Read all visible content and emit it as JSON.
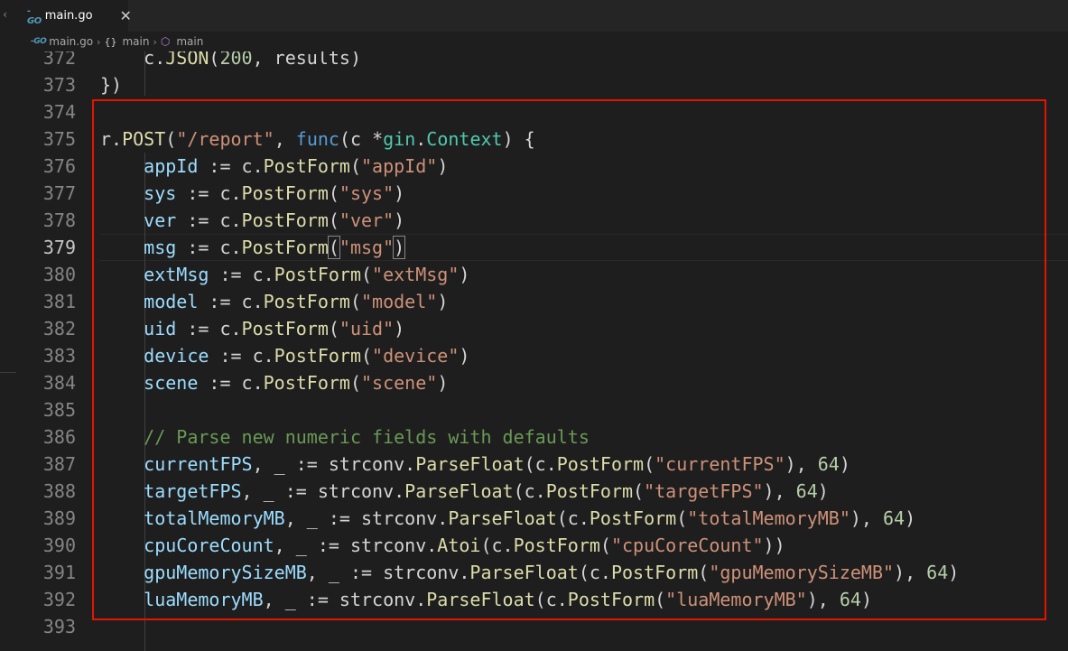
{
  "tab": {
    "icon": "go-file-icon",
    "title": "main.go",
    "close": "✕"
  },
  "breadcrumb": {
    "file": "main.go",
    "scope1_label": "main",
    "scope2_label": "main",
    "separator": "›"
  },
  "editor": {
    "active_line": 379,
    "lines": [
      {
        "n": "372",
        "segs": [
          [
            "    c.",
            "plain"
          ],
          [
            "JSON",
            "fn"
          ],
          [
            "(",
            "plain"
          ],
          [
            "200",
            "num"
          ],
          [
            ", results)",
            "plain"
          ]
        ]
      },
      {
        "n": "373",
        "segs": [
          [
            "})",
            "plain"
          ]
        ]
      },
      {
        "n": "374",
        "segs": []
      },
      {
        "n": "375",
        "segs": [
          [
            "r.",
            "plain"
          ],
          [
            "POST",
            "fn"
          ],
          [
            "(",
            "plain"
          ],
          [
            "\"/report\"",
            "str"
          ],
          [
            ", ",
            "plain"
          ],
          [
            "func",
            "kw"
          ],
          [
            "(c *",
            "plain"
          ],
          [
            "gin",
            "typ"
          ],
          [
            ".",
            "plain"
          ],
          [
            "Context",
            "typ"
          ],
          [
            ") {",
            "plain"
          ]
        ]
      },
      {
        "n": "376",
        "segs": [
          [
            "    ",
            "plain"
          ],
          [
            "appId",
            "var"
          ],
          [
            " := c.",
            "plain"
          ],
          [
            "PostForm",
            "fn"
          ],
          [
            "(",
            "plain"
          ],
          [
            "\"appId\"",
            "str"
          ],
          [
            ")",
            "plain"
          ]
        ]
      },
      {
        "n": "377",
        "segs": [
          [
            "    ",
            "plain"
          ],
          [
            "sys",
            "var"
          ],
          [
            " := c.",
            "plain"
          ],
          [
            "PostForm",
            "fn"
          ],
          [
            "(",
            "plain"
          ],
          [
            "\"sys\"",
            "str"
          ],
          [
            ")",
            "plain"
          ]
        ]
      },
      {
        "n": "378",
        "segs": [
          [
            "    ",
            "plain"
          ],
          [
            "ver",
            "var"
          ],
          [
            " := c.",
            "plain"
          ],
          [
            "PostForm",
            "fn"
          ],
          [
            "(",
            "plain"
          ],
          [
            "\"ver\"",
            "str"
          ],
          [
            ")",
            "plain"
          ]
        ]
      },
      {
        "n": "379",
        "segs": [
          [
            "    ",
            "plain"
          ],
          [
            "msg",
            "var"
          ],
          [
            " := c.",
            "plain"
          ],
          [
            "PostForm",
            "fn"
          ],
          [
            "(",
            "plain-hl"
          ],
          [
            "\"msg\"",
            "str"
          ],
          [
            ")",
            "plain-hl"
          ]
        ]
      },
      {
        "n": "380",
        "segs": [
          [
            "    ",
            "plain"
          ],
          [
            "extMsg",
            "var"
          ],
          [
            " := c.",
            "plain"
          ],
          [
            "PostForm",
            "fn"
          ],
          [
            "(",
            "plain"
          ],
          [
            "\"extMsg\"",
            "str"
          ],
          [
            ")",
            "plain"
          ]
        ]
      },
      {
        "n": "381",
        "segs": [
          [
            "    ",
            "plain"
          ],
          [
            "model",
            "var"
          ],
          [
            " := c.",
            "plain"
          ],
          [
            "PostForm",
            "fn"
          ],
          [
            "(",
            "plain"
          ],
          [
            "\"model\"",
            "str"
          ],
          [
            ")",
            "plain"
          ]
        ]
      },
      {
        "n": "382",
        "segs": [
          [
            "    ",
            "plain"
          ],
          [
            "uid",
            "var"
          ],
          [
            " := c.",
            "plain"
          ],
          [
            "PostForm",
            "fn"
          ],
          [
            "(",
            "plain"
          ],
          [
            "\"uid\"",
            "str"
          ],
          [
            ")",
            "plain"
          ]
        ]
      },
      {
        "n": "383",
        "segs": [
          [
            "    ",
            "plain"
          ],
          [
            "device",
            "var"
          ],
          [
            " := c.",
            "plain"
          ],
          [
            "PostForm",
            "fn"
          ],
          [
            "(",
            "plain"
          ],
          [
            "\"device\"",
            "str"
          ],
          [
            ")",
            "plain"
          ]
        ]
      },
      {
        "n": "384",
        "segs": [
          [
            "    ",
            "plain"
          ],
          [
            "scene",
            "var"
          ],
          [
            " := c.",
            "plain"
          ],
          [
            "PostForm",
            "fn"
          ],
          [
            "(",
            "plain"
          ],
          [
            "\"scene\"",
            "str"
          ],
          [
            ")",
            "plain"
          ]
        ]
      },
      {
        "n": "385",
        "segs": []
      },
      {
        "n": "386",
        "segs": [
          [
            "    ",
            "plain"
          ],
          [
            "// Parse new numeric fields with defaults",
            "cmt"
          ]
        ]
      },
      {
        "n": "387",
        "segs": [
          [
            "    ",
            "plain"
          ],
          [
            "currentFPS",
            "var"
          ],
          [
            ", _ := strconv.",
            "plain"
          ],
          [
            "ParseFloat",
            "fn"
          ],
          [
            "(c.",
            "plain"
          ],
          [
            "PostForm",
            "fn"
          ],
          [
            "(",
            "plain"
          ],
          [
            "\"currentFPS\"",
            "str"
          ],
          [
            "), ",
            "plain"
          ],
          [
            "64",
            "num"
          ],
          [
            ")",
            "plain"
          ]
        ]
      },
      {
        "n": "388",
        "segs": [
          [
            "    ",
            "plain"
          ],
          [
            "targetFPS",
            "var"
          ],
          [
            ", _ := strconv.",
            "plain"
          ],
          [
            "ParseFloat",
            "fn"
          ],
          [
            "(c.",
            "plain"
          ],
          [
            "PostForm",
            "fn"
          ],
          [
            "(",
            "plain"
          ],
          [
            "\"targetFPS\"",
            "str"
          ],
          [
            "), ",
            "plain"
          ],
          [
            "64",
            "num"
          ],
          [
            ")",
            "plain"
          ]
        ]
      },
      {
        "n": "389",
        "segs": [
          [
            "    ",
            "plain"
          ],
          [
            "totalMemoryMB",
            "var"
          ],
          [
            ", _ := strconv.",
            "plain"
          ],
          [
            "ParseFloat",
            "fn"
          ],
          [
            "(c.",
            "plain"
          ],
          [
            "PostForm",
            "fn"
          ],
          [
            "(",
            "plain"
          ],
          [
            "\"totalMemoryMB\"",
            "str"
          ],
          [
            "), ",
            "plain"
          ],
          [
            "64",
            "num"
          ],
          [
            ")",
            "plain"
          ]
        ]
      },
      {
        "n": "390",
        "segs": [
          [
            "    ",
            "plain"
          ],
          [
            "cpuCoreCount",
            "var"
          ],
          [
            ", _ := strconv.",
            "plain"
          ],
          [
            "Atoi",
            "fn"
          ],
          [
            "(c.",
            "plain"
          ],
          [
            "PostForm",
            "fn"
          ],
          [
            "(",
            "plain"
          ],
          [
            "\"cpuCoreCount\"",
            "str"
          ],
          [
            "))",
            "plain"
          ]
        ]
      },
      {
        "n": "391",
        "segs": [
          [
            "    ",
            "plain"
          ],
          [
            "gpuMemorySizeMB",
            "var"
          ],
          [
            ", _ := strconv.",
            "plain"
          ],
          [
            "ParseFloat",
            "fn"
          ],
          [
            "(c.",
            "plain"
          ],
          [
            "PostForm",
            "fn"
          ],
          [
            "(",
            "plain"
          ],
          [
            "\"gpuMemorySizeMB\"",
            "str"
          ],
          [
            "), ",
            "plain"
          ],
          [
            "64",
            "num"
          ],
          [
            ")",
            "plain"
          ]
        ]
      },
      {
        "n": "392",
        "segs": [
          [
            "    ",
            "plain"
          ],
          [
            "luaMemoryMB",
            "var"
          ],
          [
            ", _ := strconv.",
            "plain"
          ],
          [
            "ParseFloat",
            "fn"
          ],
          [
            "(c.",
            "plain"
          ],
          [
            "PostForm",
            "fn"
          ],
          [
            "(",
            "plain"
          ],
          [
            "\"luaMemoryMB\"",
            "str"
          ],
          [
            "), ",
            "plain"
          ],
          [
            "64",
            "num"
          ],
          [
            ")",
            "plain"
          ]
        ]
      },
      {
        "n": "393",
        "segs": []
      }
    ]
  },
  "colors": {
    "background": "#1e1e1e",
    "highlight_box": "#e51400",
    "keyword": "#569cd6",
    "function": "#dcdcaa",
    "string": "#ce9178",
    "variable": "#9cdcfe",
    "type": "#4ec9b0",
    "number": "#b5cea8",
    "comment": "#6a9955"
  }
}
